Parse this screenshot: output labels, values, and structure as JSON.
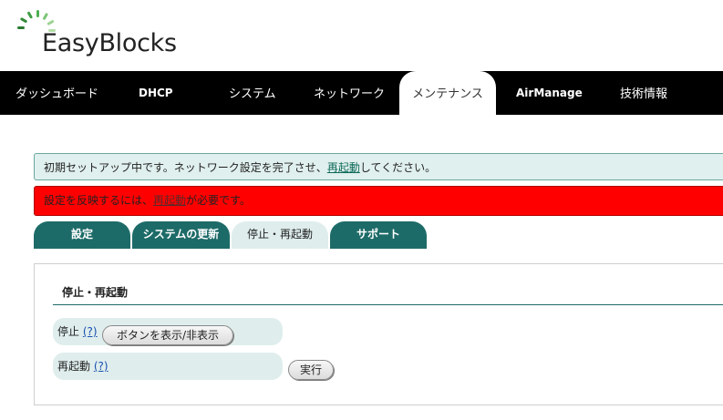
{
  "logo": {
    "text": "EasyBlocks"
  },
  "nav": {
    "items": [
      {
        "label": "ダッシュボード"
      },
      {
        "label": "DHCP"
      },
      {
        "label": "システム"
      },
      {
        "label": "ネットワーク"
      },
      {
        "label": "メンテナンス"
      },
      {
        "label": "AirManage"
      },
      {
        "label": "技術情報"
      }
    ],
    "active_index": 4
  },
  "notices": {
    "info": {
      "before": "初期セットアップ中です。ネットワーク設定を完了させ、",
      "link": "再起動",
      "after": "してください。"
    },
    "error": {
      "before": "設定を反映するには、",
      "link": "再起動",
      "after": "が必要です。"
    }
  },
  "tabs": [
    {
      "label": "設定"
    },
    {
      "label": "システムの更新"
    },
    {
      "label": "停止・再起動"
    },
    {
      "label": "サポート"
    }
  ],
  "panel": {
    "title": "停止・再起動",
    "rows": [
      {
        "label": "停止",
        "help": "(?)",
        "button": "ボタンを表示/非表示"
      },
      {
        "label": "再起動",
        "help": "(?)",
        "button": "実行"
      }
    ]
  },
  "colors": {
    "nav_bg": "#000000",
    "tab_bg": "#1d6b68",
    "notice_info_bg": "#e0f0ee",
    "notice_error_bg": "#ff0000",
    "logo_green": "#4caf50"
  }
}
